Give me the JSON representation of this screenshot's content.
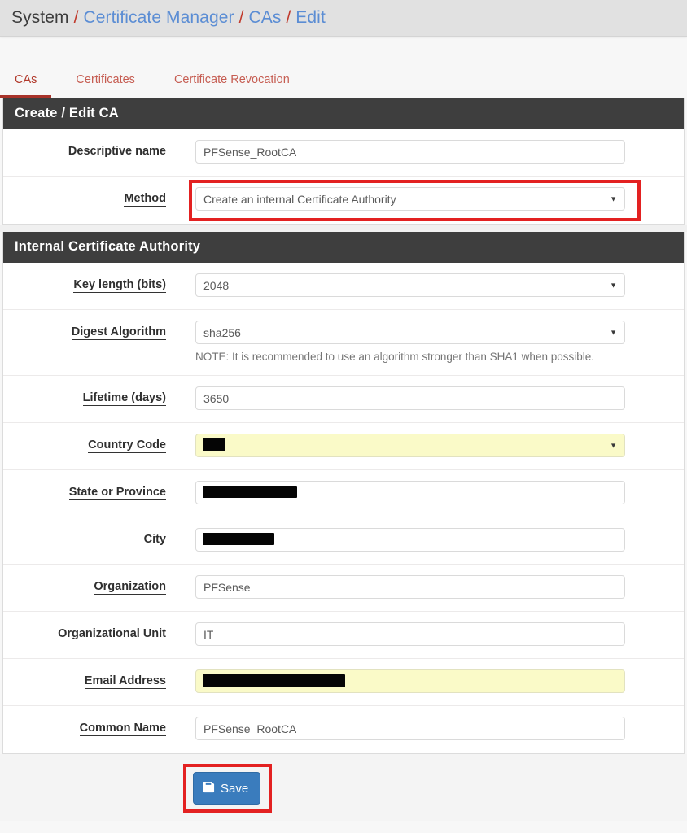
{
  "breadcrumb": {
    "root": "System",
    "sep": "/",
    "links": [
      "Certificate Manager",
      "CAs",
      "Edit"
    ]
  },
  "tabs": [
    {
      "label": "CAs",
      "active": true
    },
    {
      "label": "Certificates",
      "active": false
    },
    {
      "label": "Certificate Revocation",
      "active": false
    }
  ],
  "panels": {
    "create_edit": {
      "heading": "Create / Edit CA",
      "descriptive_name": {
        "label": "Descriptive name",
        "value": "PFSense_RootCA"
      },
      "method": {
        "label": "Method",
        "value": "Create an internal Certificate Authority",
        "caret": "▼"
      }
    },
    "internal_ca": {
      "heading": "Internal Certificate Authority",
      "key_length": {
        "label": "Key length (bits)",
        "value": "2048",
        "caret": "▼"
      },
      "digest": {
        "label": "Digest Algorithm",
        "value": "sha256",
        "caret": "▼",
        "note": "NOTE: It is recommended to use an algorithm stronger than SHA1 when possible."
      },
      "lifetime": {
        "label": "Lifetime (days)",
        "value": "3650"
      },
      "country_code": {
        "label": "Country Code",
        "value": "",
        "caret": "▼",
        "redacted": true
      },
      "state": {
        "label": "State or Province",
        "value": "",
        "redacted": true
      },
      "city": {
        "label": "City",
        "value": "",
        "redacted": true
      },
      "organization": {
        "label": "Organization",
        "value": "PFSense"
      },
      "org_unit": {
        "label": "Organizational Unit",
        "value": "IT"
      },
      "email": {
        "label": "Email Address",
        "value": "",
        "redacted": true
      },
      "common_name": {
        "label": "Common Name",
        "value": "PFSense_RootCA"
      }
    }
  },
  "footer": {
    "save_label": "Save",
    "save_icon": "floppy-disk-icon"
  },
  "colors": {
    "panel_heading_bg": "#3e3e3e",
    "breadcrumb_link": "#5b8dd4",
    "breadcrumb_sep": "#c0392b",
    "tab_active": "#a8332a",
    "annotation_red": "#e32121",
    "save_button_blue": "#3a7cbd",
    "autofill_yellow": "#fafac8"
  }
}
